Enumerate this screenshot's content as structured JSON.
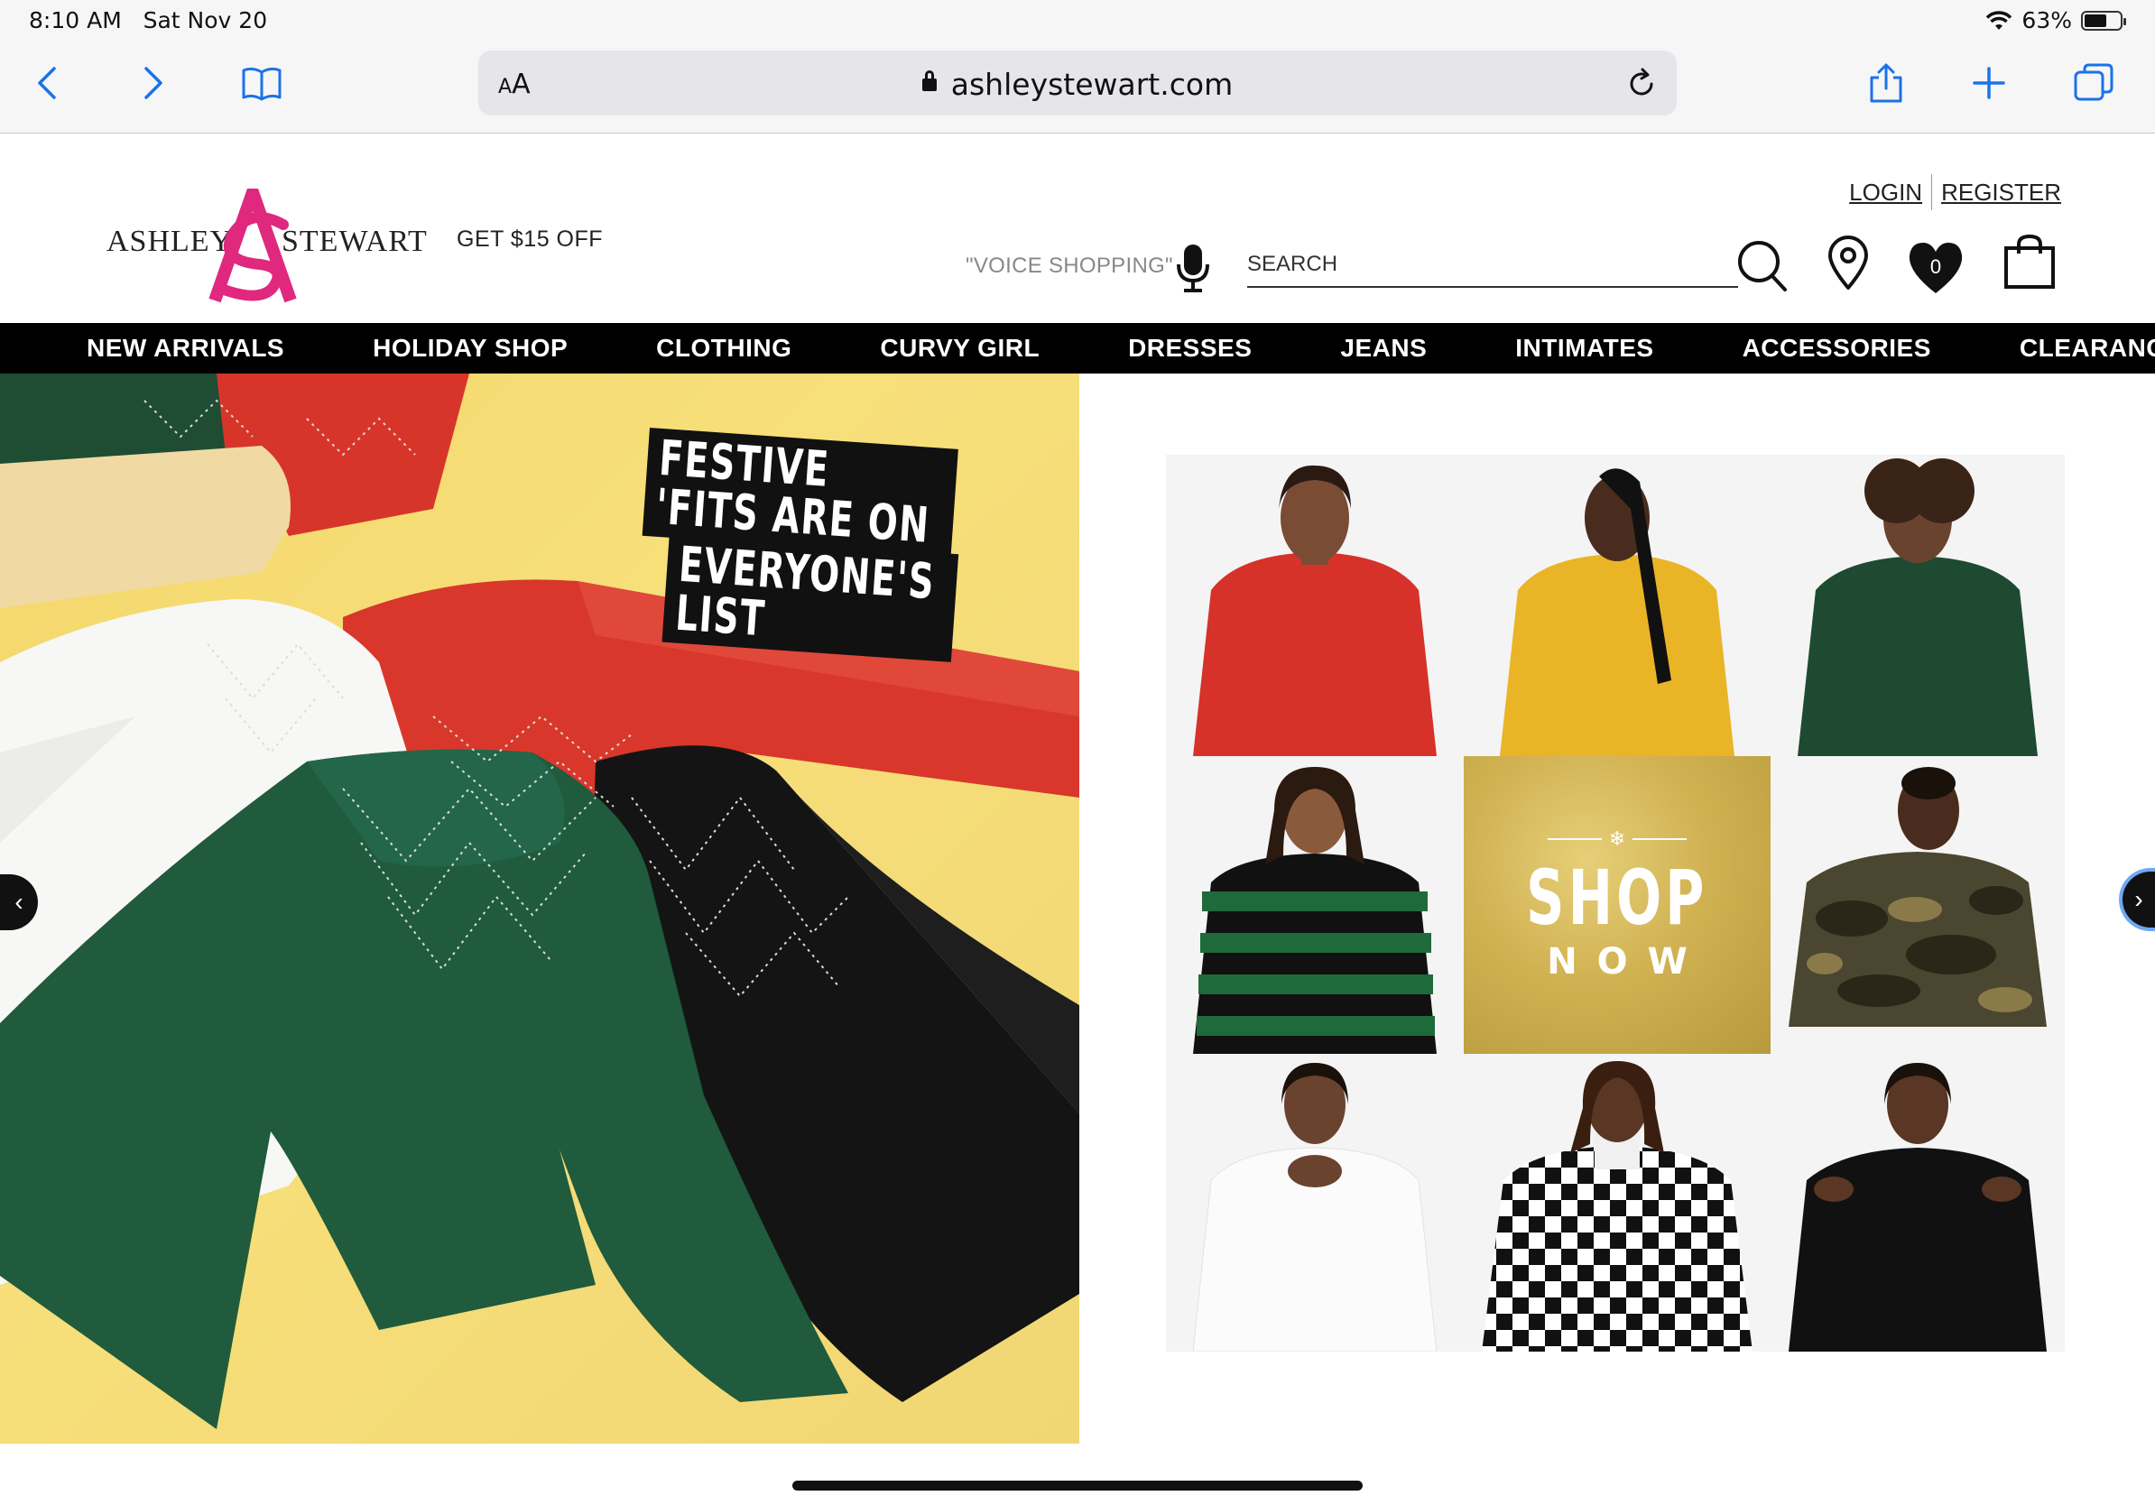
{
  "status_bar": {
    "time": "8:10 AM",
    "date": "Sat Nov 20",
    "battery_percent": "63%",
    "battery_level": 0.63
  },
  "browser": {
    "aa_label": "AA",
    "url": "ashleystewart.com",
    "icons": [
      "back-icon",
      "forward-icon",
      "bookmarks-icon",
      "reload-icon",
      "share-icon",
      "new-tab-icon",
      "tabs-icon"
    ]
  },
  "header": {
    "logo_left": "ASHLEY",
    "logo_right": "STEWART",
    "promo": "GET $15 OFF",
    "login": "LOGIN",
    "register": "REGISTER",
    "voice_label": "\"VOICE SHOPPING\"",
    "search_placeholder": "SEARCH",
    "wishlist_count": "0",
    "colors": {
      "logo_pink": "#e0287f"
    }
  },
  "nav": {
    "items": [
      {
        "label": "NEW ARRIVALS"
      },
      {
        "label": "HOLIDAY SHOP"
      },
      {
        "label": "CLOTHING"
      },
      {
        "label": "CURVY GIRL"
      },
      {
        "label": "DRESSES"
      },
      {
        "label": "JEANS"
      },
      {
        "label": "INTIMATES"
      },
      {
        "label": "ACCESSORIES"
      },
      {
        "label": "CLEARANCE"
      }
    ]
  },
  "hero": {
    "tagline_1": "FESTIVE 'FITS ARE ON",
    "tagline_2": "EVERYONE'S LIST",
    "shop_1": "SHOP",
    "shop_2": "NOW",
    "arrow_prev": "‹",
    "arrow_next": "›"
  }
}
